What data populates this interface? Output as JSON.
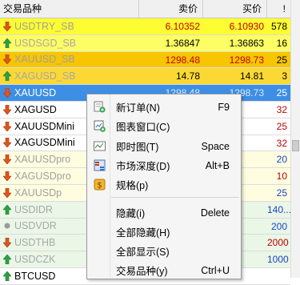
{
  "header": {
    "symbol": "交易品种",
    "sell": "卖价",
    "buy": "买价",
    "spread": "!"
  },
  "rows": [
    {
      "symbol": "USDTRY_SB",
      "sell": "6.10352",
      "buy": "6.10930",
      "spread": "578",
      "bg": "#fdfd32",
      "text": "#a0a0a0",
      "arrow": "down",
      "numColor": "#c00000",
      "spColor": "#000"
    },
    {
      "symbol": "USDSGD_SB",
      "sell": "1.36847",
      "buy": "1.36863",
      "spread": "16",
      "bg": "#fdfd64",
      "text": "#a8a8a8",
      "arrow": "up",
      "numColor": "#000",
      "spColor": "#000"
    },
    {
      "symbol": "XAUUSD_SB",
      "sell": "1298.48",
      "buy": "1298.73",
      "spread": "25",
      "bg": "#f7c600",
      "text": "#a0a0a0",
      "arrow": "down",
      "numColor": "#c00000",
      "spColor": "#000"
    },
    {
      "symbol": "XAGUSD_SB",
      "sell": "14.78",
      "buy": "14.81",
      "spread": "3",
      "bg": "#fcd835",
      "text": "#a8a8a8",
      "arrow": "up",
      "numColor": "#000",
      "spColor": "#000"
    },
    {
      "symbol": "XAUUSD",
      "sell": "1298.48",
      "buy": "1298.73",
      "spread": "25",
      "bg": "#3d8ee4",
      "text": "#ffffff",
      "arrow": "down",
      "numColor": "#dbe8f8",
      "spColor": "#ffffff"
    },
    {
      "symbol": "XAGUSD",
      "sell": "",
      "buy": "",
      "spread": "32",
      "bg": "#ffffff",
      "text": "#000",
      "arrow": "down",
      "numColor": "#000",
      "spColor": "#c00000"
    },
    {
      "symbol": "XAUUSDMini",
      "sell": "",
      "buy": "",
      "spread": "25",
      "bg": "#ffffff",
      "text": "#000",
      "arrow": "down",
      "numColor": "#000",
      "spColor": "#c00000"
    },
    {
      "symbol": "XAGUSDMini",
      "sell": "",
      "buy": "",
      "spread": "32",
      "bg": "#ffffff",
      "text": "#000",
      "arrow": "down",
      "numColor": "#000",
      "spColor": "#c00000"
    },
    {
      "symbol": "XAUUSDpro",
      "sell": "",
      "buy": "",
      "spread": "20",
      "bg": "#fffde0",
      "text": "#a0a0a0",
      "arrow": "down",
      "numColor": "#000",
      "spColor": "#1a44c8"
    },
    {
      "symbol": "XAGUSDpro",
      "sell": "",
      "buy": "",
      "spread": "10",
      "bg": "#fffde0",
      "text": "#a0a0a0",
      "arrow": "down",
      "numColor": "#000",
      "spColor": "#c00000"
    },
    {
      "symbol": "XAUUSDp",
      "sell": "",
      "buy": "",
      "spread": "25",
      "bg": "#fffde0",
      "text": "#a0a0a0",
      "arrow": "down",
      "numColor": "#000",
      "spColor": "#1a44c8"
    },
    {
      "symbol": "USDIDR",
      "sell": "",
      "buy": "",
      "spread": "140...",
      "bg": "#eaf6e6",
      "text": "#a8a8a8",
      "arrow": "up",
      "numColor": "#000",
      "spColor": "#1a44c8"
    },
    {
      "symbol": "USDVDR",
      "sell": "",
      "buy": "",
      "spread": "200",
      "bg": "#eaf6e6",
      "text": "#a8a8a8",
      "arrow": "dot",
      "numColor": "#000",
      "spColor": "#1a44c8"
    },
    {
      "symbol": "USDTHB",
      "sell": "",
      "buy": "",
      "spread": "2000",
      "bg": "#eaf6e6",
      "text": "#a8a8a8",
      "arrow": "down",
      "numColor": "#000",
      "spColor": "#c00000"
    },
    {
      "symbol": "USDCZK",
      "sell": "",
      "buy": "",
      "spread": "1000",
      "bg": "#eaf6e6",
      "text": "#a8a8a8",
      "arrow": "up",
      "numColor": "#000",
      "spColor": "#1a44c8"
    },
    {
      "symbol": "BTCUSD",
      "sell": "",
      "buy": "",
      "spread": "",
      "bg": "#ffffff",
      "text": "#000",
      "arrow": "up",
      "numColor": "#000",
      "spColor": "#000"
    }
  ],
  "menu": {
    "items": [
      {
        "label": "新订单(N)",
        "shortcut": "F9",
        "icon": "new-order-icon"
      },
      {
        "label": "图表窗口(C)",
        "shortcut": "",
        "icon": "chart-window-icon"
      },
      {
        "label": "即时图(T)",
        "shortcut": "Space",
        "icon": "tick-chart-icon"
      },
      {
        "label": "市场深度(D)",
        "shortcut": "Alt+B",
        "icon": "market-depth-icon"
      },
      {
        "label": "规格(p)",
        "shortcut": "",
        "icon": "specification-icon"
      },
      {
        "label": "隐藏(i)",
        "shortcut": "Delete",
        "icon": ""
      },
      {
        "label": "全部隐藏(H)",
        "shortcut": "",
        "icon": ""
      },
      {
        "label": "全部显示(S)",
        "shortcut": "",
        "icon": ""
      },
      {
        "label": "交易品种(y)",
        "shortcut": "Ctrl+U",
        "icon": ""
      }
    ]
  },
  "colors": {
    "highlight_border": "#e03c2c",
    "selected_row": "#3d8ee4",
    "up_arrow": "#2ea043",
    "down_arrow": "#e0541e"
  }
}
